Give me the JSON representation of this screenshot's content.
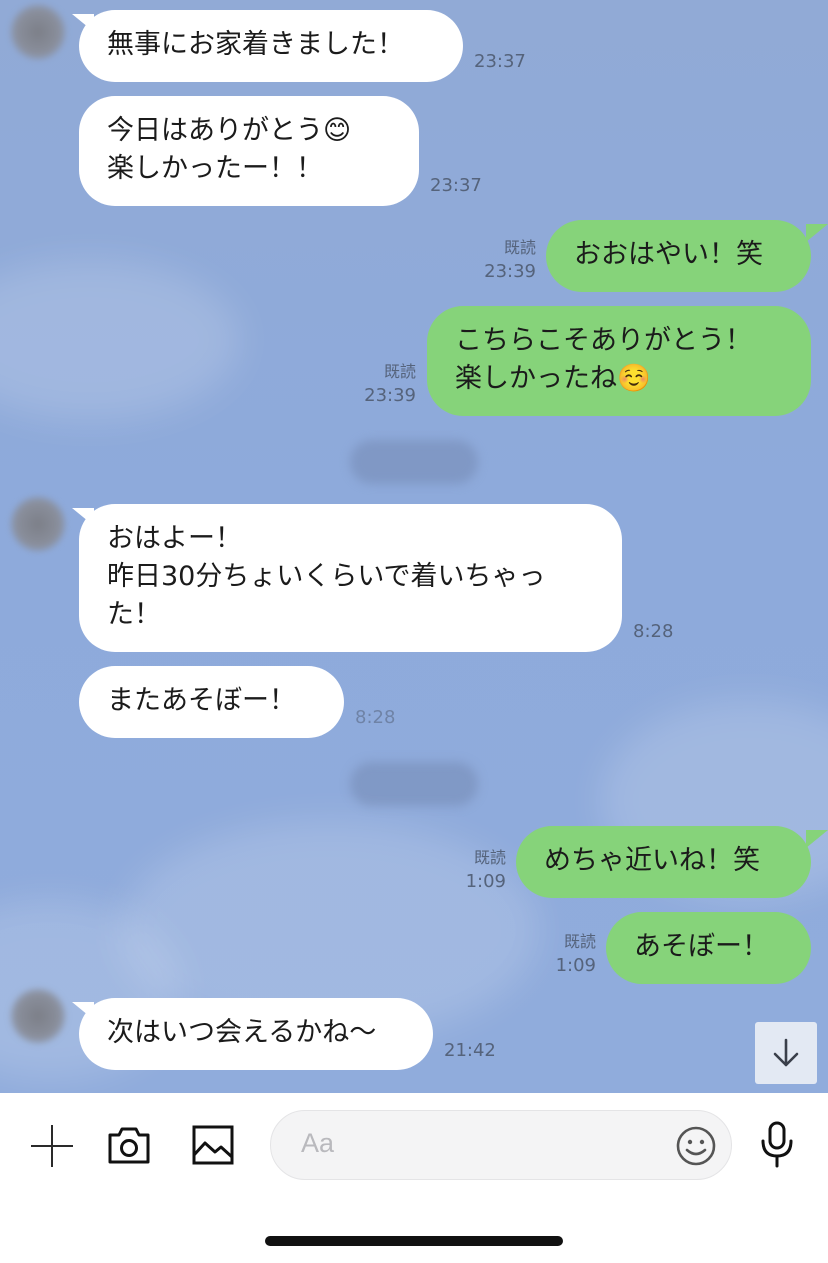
{
  "messages": [
    {
      "dir": "in",
      "text": "無事にお家着きました！",
      "time": "23:37"
    },
    {
      "dir": "in",
      "text": "今日はありがとう😊\n楽しかったー！！",
      "time": "23:37"
    },
    {
      "dir": "out",
      "text": "おおはやい！笑",
      "read": "既読",
      "time": "23:39"
    },
    {
      "dir": "out",
      "text": "こちらこそありがとう！\n楽しかったね☺️",
      "read": "既読",
      "time": "23:39"
    },
    {
      "dir": "in",
      "text": "おはよー！\n昨日30分ちょいくらいで着いちゃった！",
      "time": "8:28"
    },
    {
      "dir": "in",
      "text": "またあそぼー！",
      "time": "8:28"
    },
    {
      "dir": "out",
      "text": "めちゃ近いね！笑",
      "read": "既読",
      "time": "1:09"
    },
    {
      "dir": "out",
      "text": "あそぼー！",
      "read": "既読",
      "time": "1:09"
    },
    {
      "dir": "in",
      "text": "次はいつ会えるかね〜",
      "time": "21:42"
    }
  ],
  "input": {
    "placeholder": "Aa"
  },
  "icons": {
    "add": "plus-icon",
    "camera": "camera-icon",
    "image": "image-icon",
    "emoji": "emoji-icon",
    "mic": "microphone-icon",
    "scroll": "arrow-down-icon"
  },
  "colors": {
    "background": "#8eaadb",
    "incoming_bubble": "#ffffff",
    "outgoing_bubble": "#86d37a"
  }
}
